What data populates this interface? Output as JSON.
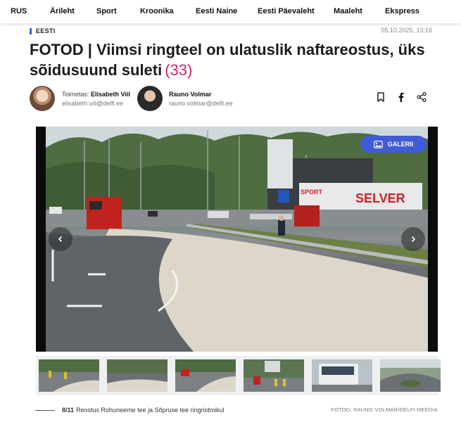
{
  "nav": {
    "items": [
      "RUS",
      "Ärileht",
      "Sport",
      "Kroonika",
      "Eesti Naine",
      "Eesti Päevaleht",
      "Maaleht",
      "Ekspress"
    ]
  },
  "article": {
    "section": "EESTI",
    "date": "05.10.2025, 13:16",
    "title": "FOTOD | Viimsi ringteel on ulatuslik naftareostus, üks sõidusuund suleti",
    "comment_count": "(33)"
  },
  "authors": [
    {
      "role": "Toimetas:",
      "name": "Elisabeth Viil",
      "email": "elisabeth.viil@delfi.ee"
    },
    {
      "role": "",
      "name": "Rauno Volmar",
      "email": "rauno.volmar@delfi.ee"
    }
  ],
  "actions": {
    "icons": [
      "bookmark-icon",
      "facebook-icon",
      "share-icon"
    ]
  },
  "gallery": {
    "button_label": "GALERII",
    "current": "8/11",
    "caption": "Reostus Rohuneeme tee ja Sõpruse tee ringristmikul",
    "credit": "FOTOD: RAUNO VOLMAR/DELFI MEEDIA",
    "photo_text": {
      "store_sign": "SELVER",
      "store_sign_2": "SPORT"
    },
    "thumbnail_count": 6
  },
  "colors": {
    "accent": "#3f5bd6",
    "comment_count": "#d4226a"
  }
}
